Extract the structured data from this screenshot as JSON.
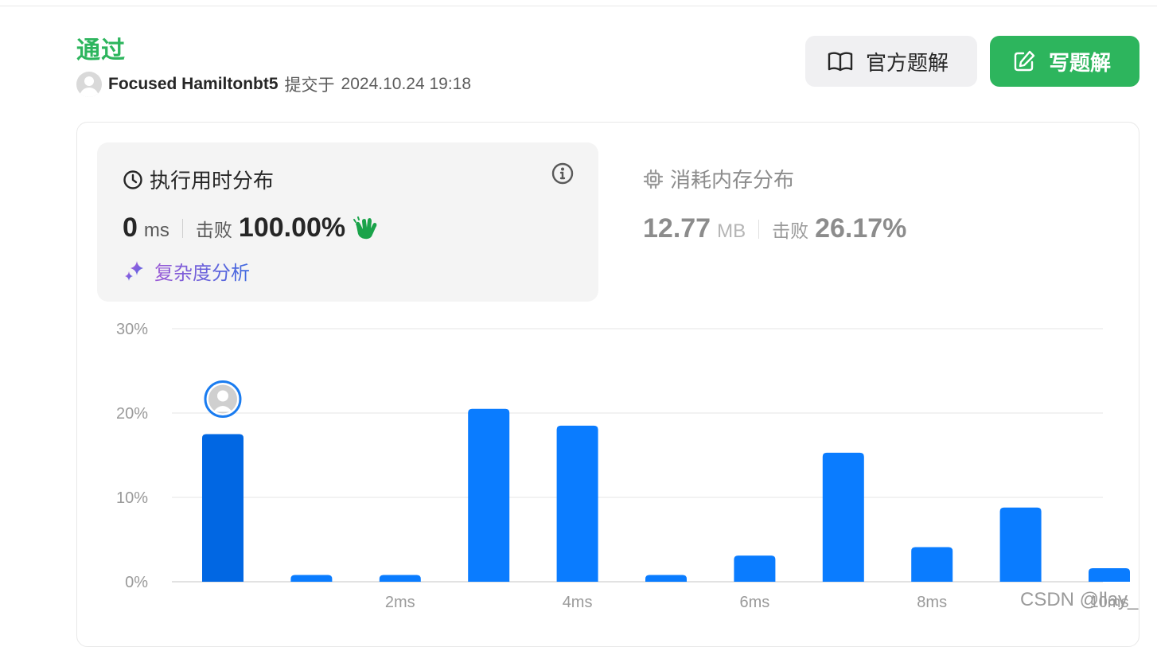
{
  "header": {
    "status": "通过",
    "username": "Focused Hamiltonbt5",
    "submit_label": "提交于",
    "submit_time": "2024.10.24 19:18"
  },
  "actions": {
    "official_solution": "官方题解",
    "write_solution": "写题解"
  },
  "runtime": {
    "title": "执行用时分布",
    "value": "0",
    "unit": "ms",
    "beat_label": "击败",
    "beat_percent": "100.00%",
    "complexity_link": "复杂度分析"
  },
  "memory": {
    "title": "消耗内存分布",
    "value": "12.77",
    "unit": "MB",
    "beat_label": "击败",
    "beat_percent": "26.17%"
  },
  "colors": {
    "accent_green": "#2db55d",
    "bar_blue": "#0a7cff",
    "bar_highlight": "#0167e3"
  },
  "chart_data": {
    "type": "bar",
    "categories": [
      "0ms",
      "1ms",
      "2ms",
      "3ms",
      "4ms",
      "5ms",
      "6ms",
      "7ms",
      "8ms",
      "9ms",
      "10ms"
    ],
    "values": [
      17.5,
      0.8,
      0.8,
      20.5,
      18.5,
      0.8,
      3.1,
      15.3,
      4.1,
      8.8,
      1.6
    ],
    "highlight_index": 0,
    "ylim": [
      0,
      30
    ],
    "yticks": [
      "0%",
      "10%",
      "20%",
      "30%"
    ],
    "xtick_labels": [
      "2ms",
      "4ms",
      "6ms",
      "8ms",
      "10ms"
    ],
    "grid": true
  },
  "watermark": "CSDN @llay_"
}
